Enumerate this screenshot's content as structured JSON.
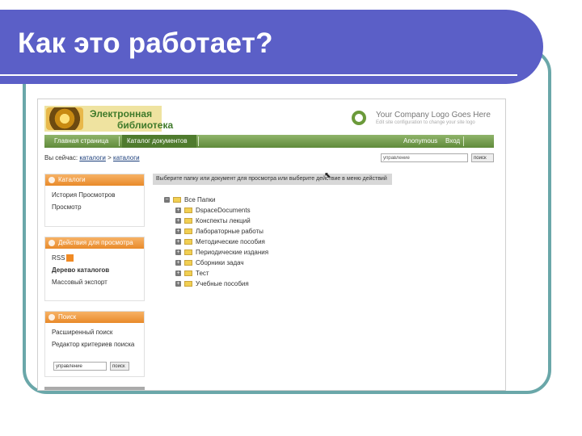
{
  "slide": {
    "title": "Как это работает?"
  },
  "header": {
    "logo_line1": "Электронная",
    "logo_line2": "библиотека",
    "company_title": "Your Company Logo Goes Here",
    "company_sub": "Edit site configuration to change your site logo"
  },
  "nav": {
    "items": [
      "Главная страница",
      "Каталог документов",
      "Anonymous",
      "Вход"
    ]
  },
  "breadcrumb": {
    "prefix": "Вы сейчас:",
    "link1": "каталоги",
    "sep": ">",
    "link2": "каталоги"
  },
  "search": {
    "value": "управление",
    "button": "поиск"
  },
  "sidebar": {
    "catalogs": {
      "title": "Каталоги",
      "items": [
        "История Просмотров",
        "Просмотр"
      ]
    },
    "actions": {
      "title": "Действия для просмотра",
      "items": [
        "RSS",
        "Дерево каталогов",
        "Массовый экспорт"
      ]
    },
    "search": {
      "title": "Поиск",
      "items": [
        "Расширенный поиск",
        "Редактор критериев поиска"
      ],
      "input_value": "управление",
      "button": "поиск"
    }
  },
  "main": {
    "hint": "Выберите папку или документ для просмотра или выберите действие в меню действий",
    "root": "Все Папки",
    "folders": [
      "DspaceDocuments",
      "Конспекты лекций",
      "Лабораторные работы",
      "Методические пособия",
      "Периодические издания",
      "Сборники задач",
      "Тест",
      "Учебные пособия"
    ]
  },
  "colors": {
    "title_bar": "#5b5fc7",
    "frame": "#6aa7a9",
    "nav_green": "#5f8a3a",
    "side_orange": "#e98a2a"
  }
}
